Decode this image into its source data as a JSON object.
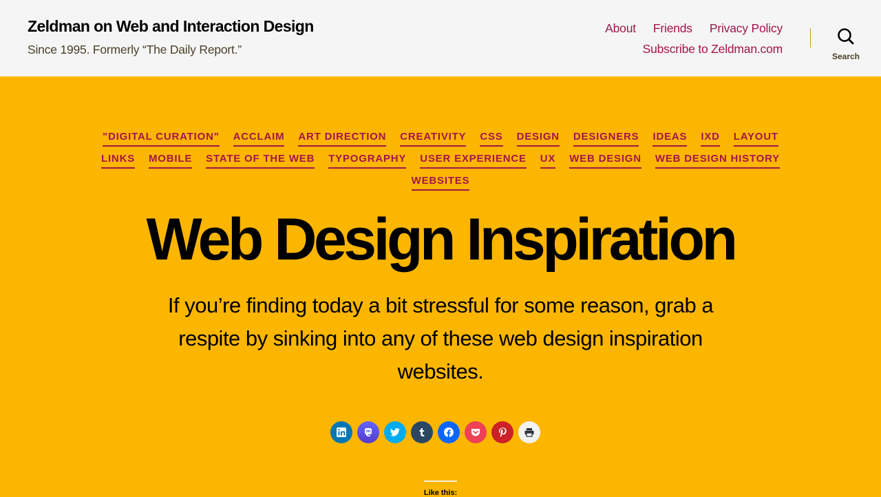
{
  "header": {
    "site_title": "Zeldman on Web and Interaction Design",
    "site_description": "Since 1995. Formerly “The Daily Report.”",
    "menu": [
      {
        "label": "About"
      },
      {
        "label": "Friends"
      },
      {
        "label": "Privacy Policy"
      },
      {
        "label": "Subscribe to Zeldman.com"
      }
    ],
    "search_label": "Search",
    "search_icon": "search-icon"
  },
  "colors": {
    "background": "#fdb600",
    "header_bg": "#f5f5f5",
    "accent": "#a3154a",
    "text": "#000000"
  },
  "post": {
    "categories": [
      "\"DIGITAL CURATION\"",
      "ACCLAIM",
      "ART DIRECTION",
      "CREATIVITY",
      "CSS",
      "DESIGN",
      "DESIGNERS",
      "IDEAS",
      "IXD",
      "LAYOUT",
      "LINKS",
      "MOBILE",
      "STATE OF THE WEB",
      "TYPOGRAPHY",
      "USER EXPERIENCE",
      "UX",
      "WEB DESIGN",
      "WEB DESIGN HISTORY",
      "WEBSITES"
    ],
    "title": "Web Design Inspiration",
    "intro": "If you’re finding today a bit stressful for some reason, grab a respite by sinking into any of these web design inspiration websites."
  },
  "share": {
    "buttons": [
      {
        "name": "linkedin",
        "icon": "linkedin-icon",
        "color": "#0077b5",
        "glyph": "in"
      },
      {
        "name": "mastodon",
        "icon": "mastodon-icon",
        "color": "#6364ff",
        "glyph": "m"
      },
      {
        "name": "twitter",
        "icon": "twitter-icon",
        "color": "#00acee",
        "glyph": ""
      },
      {
        "name": "tumblr",
        "icon": "tumblr-icon",
        "color": "#2c4762",
        "glyph": "t"
      },
      {
        "name": "facebook",
        "icon": "facebook-icon",
        "color": "#0866ff",
        "glyph": "f"
      },
      {
        "name": "pocket",
        "icon": "pocket-icon",
        "color": "#ee4056",
        "glyph": ""
      },
      {
        "name": "pinterest",
        "icon": "pinterest-icon",
        "color": "#cc2127",
        "glyph": "p"
      },
      {
        "name": "print",
        "icon": "print-icon",
        "color": "#f2f2f2",
        "glyph": ""
      }
    ]
  },
  "likes": {
    "label": "Like this:"
  }
}
